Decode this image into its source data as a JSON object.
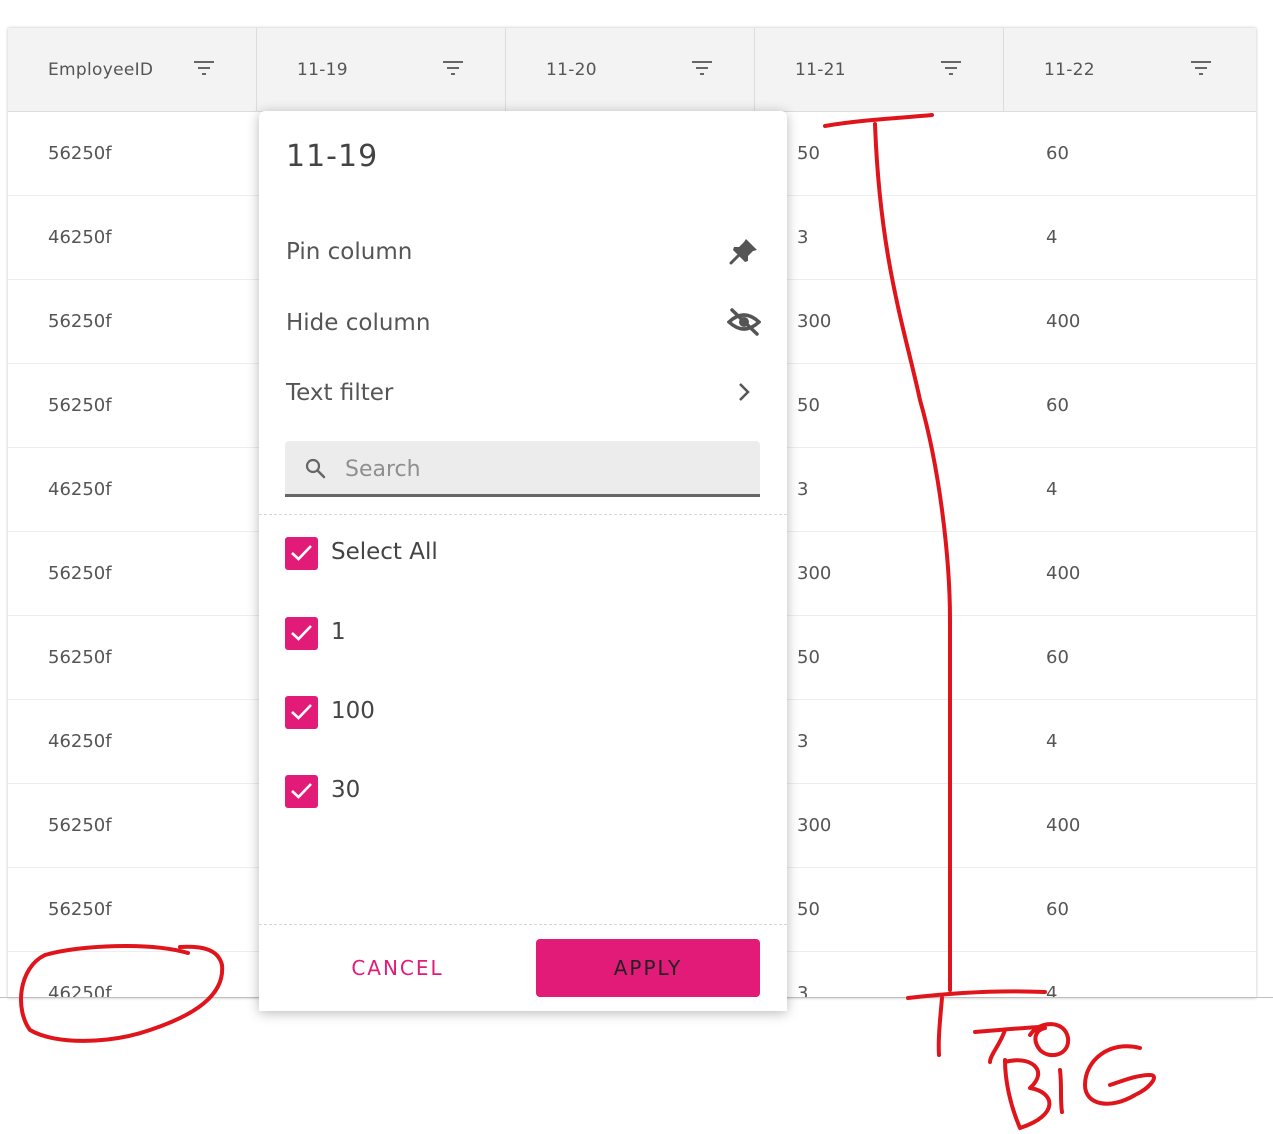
{
  "grid": {
    "columns": [
      {
        "label": "EmployeeID"
      },
      {
        "label": "11-19"
      },
      {
        "label": "11-20"
      },
      {
        "label": "11-21"
      },
      {
        "label": "11-22"
      }
    ],
    "rows": [
      {
        "id": "56250f",
        "c3": "50",
        "c4": "60"
      },
      {
        "id": "46250f",
        "c3": "3",
        "c4": "4"
      },
      {
        "id": "56250f",
        "c3": "300",
        "c4": "400"
      },
      {
        "id": "56250f",
        "c3": "50",
        "c4": "60"
      },
      {
        "id": "46250f",
        "c3": "3",
        "c4": "4"
      },
      {
        "id": "56250f",
        "c3": "300",
        "c4": "400"
      },
      {
        "id": "56250f",
        "c3": "50",
        "c4": "60"
      },
      {
        "id": "46250f",
        "c3": "3",
        "c4": "4"
      },
      {
        "id": "56250f",
        "c3": "300",
        "c4": "400"
      },
      {
        "id": "56250f",
        "c3": "50",
        "c4": "60"
      },
      {
        "id": "46250f",
        "c3": "3",
        "c4": "4"
      }
    ]
  },
  "menu": {
    "title": "11-19",
    "pin_label": "Pin column",
    "hide_label": "Hide column",
    "text_filter_label": "Text filter",
    "search_placeholder": "Search",
    "options": [
      {
        "label": "Select All",
        "checked": true
      },
      {
        "label": "1",
        "checked": true
      },
      {
        "label": "100",
        "checked": true
      },
      {
        "label": "30",
        "checked": true
      }
    ],
    "cancel_label": "CANCEL",
    "apply_label": "APPLY"
  },
  "annotation": {
    "text": "TOO BIG",
    "color": "#e0141b"
  },
  "colors": {
    "accent": "#e21b78",
    "header_bg": "#f3f3f3"
  }
}
